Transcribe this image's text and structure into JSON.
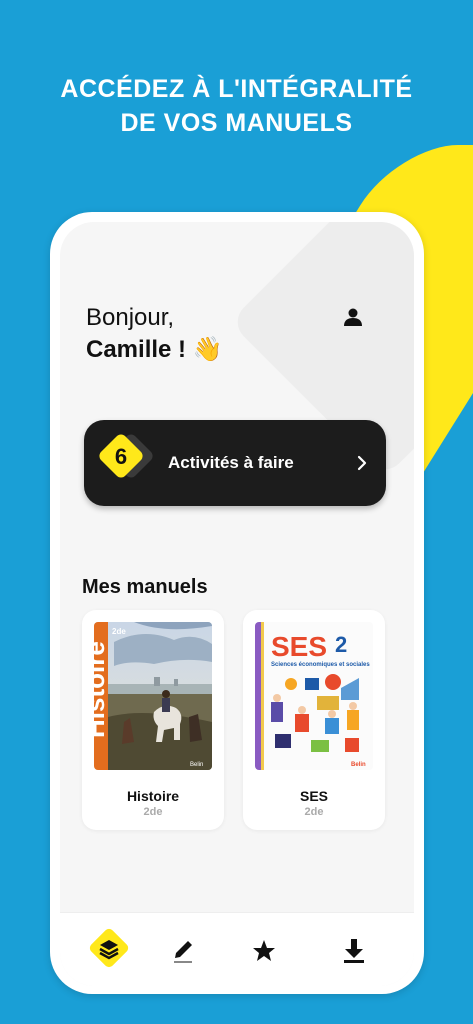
{
  "promo": {
    "line1": "ACCÉDEZ À L'INTÉGRALITÉ",
    "line2": "DE VOS MANUELS"
  },
  "greeting": {
    "hello": "Bonjour,",
    "name": "Camille !",
    "emoji": "👋"
  },
  "activities": {
    "count": "6",
    "label": "Activités à faire"
  },
  "section_title": "Mes manuels",
  "books": [
    {
      "title": "Histoire",
      "level": "2de",
      "cover_title": "Histoire",
      "cover_level": "2de",
      "publisher": "Belin"
    },
    {
      "title": "SES",
      "level": "2de",
      "cover_title": "SES",
      "cover_level": "2",
      "cover_subtitle": "Sciences économiques et sociales",
      "publisher": "Belin"
    }
  ],
  "nav": [
    "books-icon",
    "pencil-icon",
    "star-icon",
    "download-icon"
  ],
  "colors": {
    "background": "#1a9fd6",
    "accent": "#ffe81a",
    "dark": "#1c1c1c"
  }
}
